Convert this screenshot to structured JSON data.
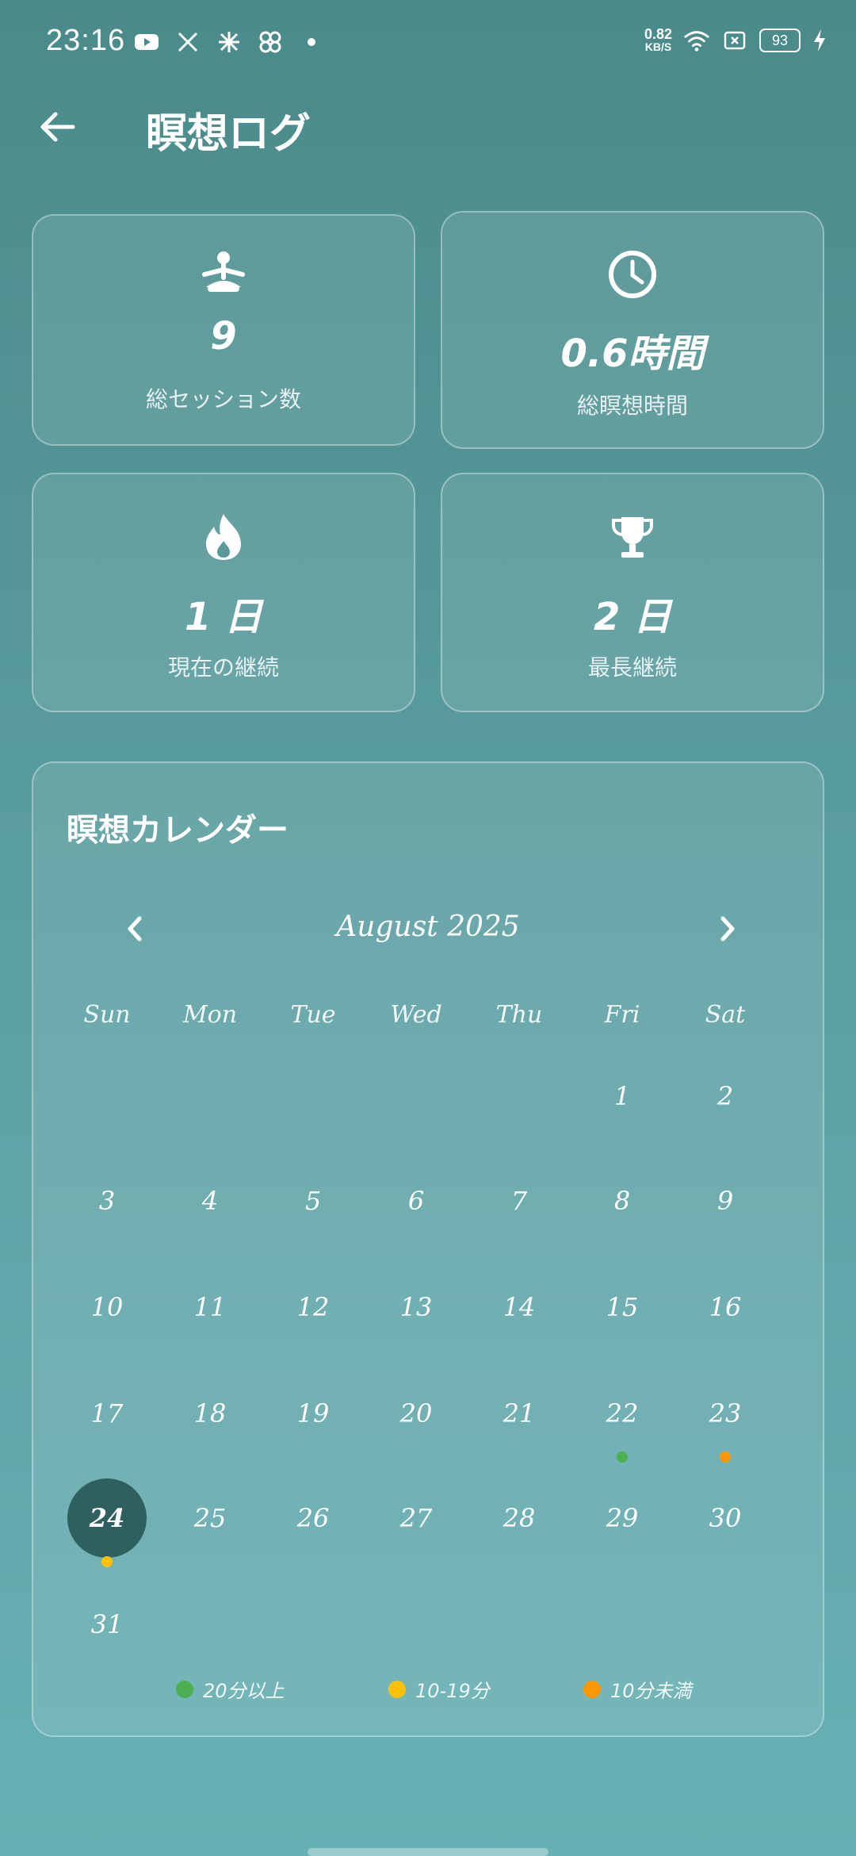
{
  "status": {
    "time": "23:16",
    "net_speed_value": "0.82",
    "net_speed_unit": "KB/S",
    "battery": "93"
  },
  "appbar": {
    "title": "瞑想ログ"
  },
  "stats": [
    {
      "icon": "meditation-icon",
      "value": "9",
      "label": "総セッション数"
    },
    {
      "icon": "clock-icon",
      "value": "0.6時間",
      "label": "総瞑想時間"
    },
    {
      "icon": "flame-icon",
      "value": "1 日",
      "label": "現在の継続"
    },
    {
      "icon": "trophy-icon",
      "value": "2 日",
      "label": "最長継続"
    }
  ],
  "calendar": {
    "title": "瞑想カレンダー",
    "month": "August 2025",
    "weekdays": [
      "Sun",
      "Mon",
      "Tue",
      "Wed",
      "Thu",
      "Fri",
      "Sat"
    ],
    "first_weekday_index": 5,
    "days": [
      "1",
      "2",
      "3",
      "4",
      "5",
      "6",
      "7",
      "8",
      "9",
      "10",
      "11",
      "12",
      "13",
      "14",
      "15",
      "16",
      "17",
      "18",
      "19",
      "20",
      "21",
      "22",
      "23",
      "24",
      "25",
      "26",
      "27",
      "28",
      "29",
      "30",
      "31"
    ],
    "selected_day": "24",
    "markers": [
      {
        "day": "22",
        "color": "#4caf50"
      },
      {
        "day": "23",
        "color": "#ff9800"
      },
      {
        "day": "24",
        "color": "#ffc107"
      }
    ],
    "legend": [
      {
        "label": "20分以上",
        "color": "#4caf50"
      },
      {
        "label": "10-19分",
        "color": "#ffc107"
      },
      {
        "label": "10分未満",
        "color": "#ff9800"
      }
    ]
  }
}
